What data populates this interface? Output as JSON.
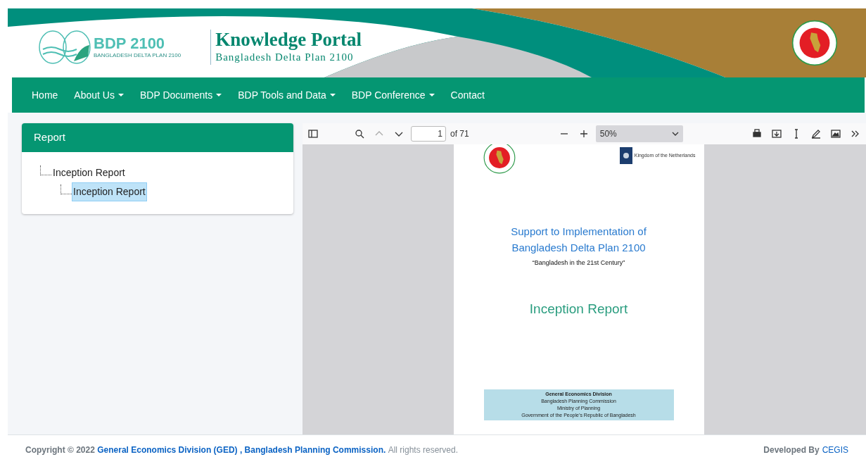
{
  "header": {
    "logo_title": "BDP 2100",
    "logo_subtitle": "BANGLADESH DELTA PLAN 2100",
    "title": "Knowledge Portal",
    "subtitle": "Bangladesh Delta Plan 2100"
  },
  "nav": [
    {
      "label": "Home",
      "dropdown": false
    },
    {
      "label": "About Us",
      "dropdown": true
    },
    {
      "label": "BDP Documents",
      "dropdown": true
    },
    {
      "label": "BDP Tools and Data",
      "dropdown": true
    },
    {
      "label": "BDP Conference",
      "dropdown": true
    },
    {
      "label": "Contact",
      "dropdown": false
    }
  ],
  "panel": {
    "title": "Report",
    "tree": [
      {
        "label": "Inception Report",
        "expanded": true,
        "selected": false,
        "children": [
          {
            "label": "Inception Report",
            "selected": true
          }
        ]
      }
    ]
  },
  "viewer": {
    "page": "1",
    "page_count": "of 71",
    "zoom": "50%"
  },
  "document": {
    "partner": "Kingdom of the Netherlands",
    "title_lines": [
      "Support to Implementation of",
      "Bangladesh Delta Plan 2100"
    ],
    "tagline": "“Bangladesh in the 21st Century”",
    "report_title": "Inception Report",
    "box_lines": [
      "General Economics Division",
      "Bangladesh Planning Commission",
      "Ministry of Planning",
      "Government of the People’s Republic of Bangladesh"
    ]
  },
  "footer": {
    "prefix": "Copyright © 2022",
    "link": "General Economics Division (GED) , Bangladesh Planning Commission.",
    "suffix": "All rights reserved.",
    "credit": "Developed By",
    "credit_link": "CEGIS"
  }
}
